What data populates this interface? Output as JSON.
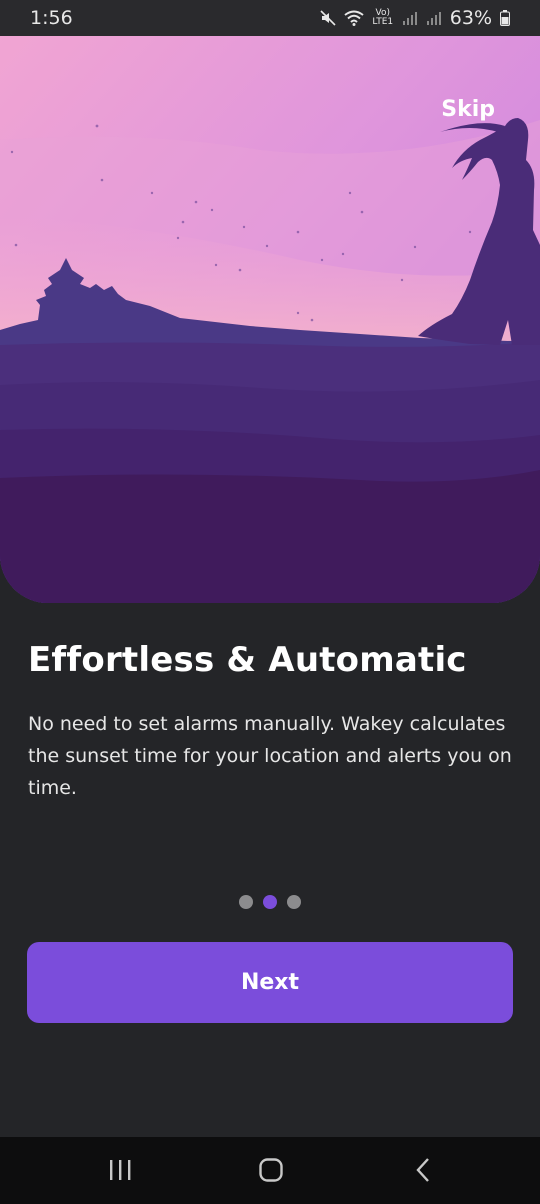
{
  "status_bar": {
    "time": "1:56",
    "network_label": "Vo) LTE1",
    "battery": "63%",
    "icons": [
      "mute-icon",
      "wifi-icon",
      "signal-icon",
      "signal-icon",
      "battery-icon"
    ]
  },
  "onboarding": {
    "skip_label": "Skip",
    "title": "Effortless & Automatic",
    "description": "No need to set alarms manually. Wakey calculates the sunset time for your location and alerts you on time.",
    "page_count": 3,
    "current_page": 2,
    "next_label": "Next"
  },
  "colors": {
    "accent": "#7b4ddb",
    "background": "#242528",
    "dot_inactive": "#8c8c8e"
  },
  "nav_bar": {
    "icons": [
      "recent-apps-icon",
      "home-icon",
      "back-icon"
    ]
  }
}
